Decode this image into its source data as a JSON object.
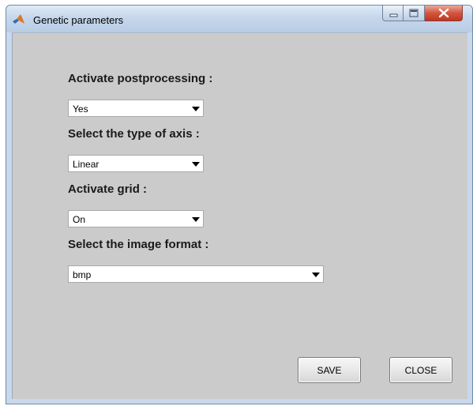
{
  "window": {
    "title": "Genetic parameters"
  },
  "fields": {
    "postprocessing": {
      "label": "Activate postprocessing :",
      "value": "Yes"
    },
    "axis_type": {
      "label": "Select the type of axis :",
      "value": "Linear"
    },
    "grid": {
      "label": "Activate grid :",
      "value": "On"
    },
    "image_format": {
      "label": "Select the image format :",
      "value": "bmp"
    }
  },
  "buttons": {
    "save_label": "SAVE",
    "close_label": "CLOSE"
  },
  "icons": {
    "app": "matlab-logo-icon",
    "minimize": "minimize-icon",
    "maximize": "maximize-icon",
    "close": "close-icon",
    "dropdown": "chevron-down-icon"
  },
  "colors": {
    "client_background": "#cbcbcb",
    "titlebar": "#c6d7ec",
    "close_button": "#c94a33"
  }
}
